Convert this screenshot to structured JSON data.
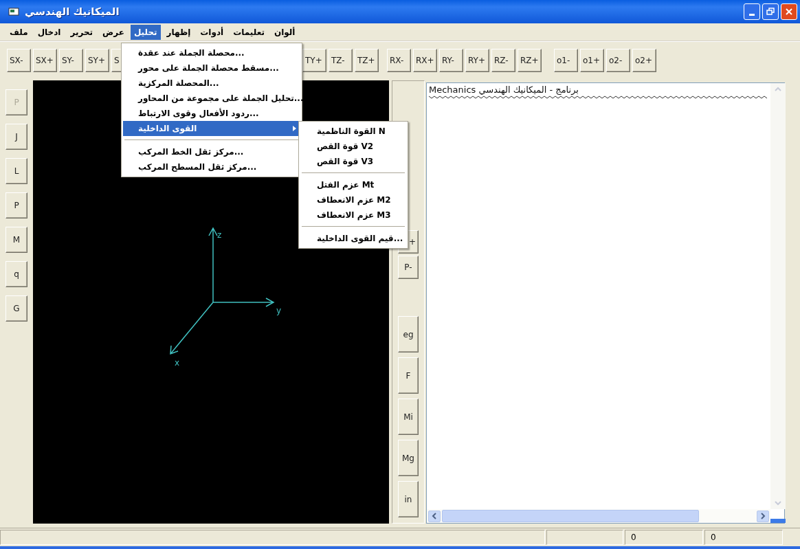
{
  "window": {
    "title": "الميكانيك الهندسي"
  },
  "menu_bar": [
    {
      "label": "ألوان",
      "selected": false
    },
    {
      "label": "تعليمات",
      "selected": false
    },
    {
      "label": "أدوات",
      "selected": false
    },
    {
      "label": "إظهار",
      "selected": false
    },
    {
      "label": "تحليل",
      "selected": true
    },
    {
      "label": "عرض",
      "selected": false
    },
    {
      "label": "تحرير",
      "selected": false
    },
    {
      "label": "ادخال",
      "selected": false
    },
    {
      "label": "ملف",
      "selected": false
    }
  ],
  "toolbar_groups": [
    [
      "o2+",
      "o2-",
      "o1+",
      "o1-"
    ],
    [
      "RZ+",
      "RZ-",
      "RY+",
      "RY-",
      "RX+",
      "RX-"
    ],
    [
      "TZ+",
      "TZ-",
      "TY+"
    ],
    [
      "S",
      "SY+",
      "SY-",
      "SX+",
      "SX-"
    ]
  ],
  "left_buttons": [
    {
      "label": "P",
      "disabled": true
    },
    {
      "label": "J",
      "disabled": false
    },
    {
      "label": "L",
      "disabled": false
    },
    {
      "label": "P",
      "disabled": false
    },
    {
      "label": "M",
      "disabled": false
    },
    {
      "label": "q",
      "disabled": false
    },
    {
      "label": "G",
      "disabled": false
    }
  ],
  "canvas": {
    "axis_labels": [
      "z",
      "y",
      "x"
    ]
  },
  "right_button_groups": [
    [
      "+",
      "P-"
    ],
    [
      "eg",
      "F",
      "Mi",
      "Mg",
      "in"
    ]
  ],
  "output": {
    "header": "Mechanics برنامج - الميكانيك الهندسي"
  },
  "dropdown": [
    {
      "kind": "item",
      "label": "محصلة الجملة عند عقدة...",
      "selected": false
    },
    {
      "kind": "item",
      "label": "مسقط محصلة الجملة على محور...",
      "selected": false
    },
    {
      "kind": "item",
      "label": "المحصلة المركزية...",
      "selected": false
    },
    {
      "kind": "item",
      "label": "تحليل الجملة على مجموعة من المحاور...",
      "selected": false
    },
    {
      "kind": "item",
      "label": "ردود الأفعال وقوى الارتباط...",
      "selected": false
    },
    {
      "kind": "submenu",
      "label": "القوى الداخلية",
      "selected": true
    },
    {
      "kind": "separator"
    },
    {
      "kind": "item",
      "label": "مركز ثقل الخط المركب...",
      "selected": false
    },
    {
      "kind": "item",
      "label": "مركز ثقل المسطح المركب...",
      "selected": false
    }
  ],
  "submenu": [
    {
      "kind": "item",
      "label": "القوة الناظمية  N",
      "selected": false
    },
    {
      "kind": "item",
      "label": "قوة القص  V2",
      "selected": false
    },
    {
      "kind": "item",
      "label": "قوة القص  V3",
      "selected": false
    },
    {
      "kind": "separator"
    },
    {
      "kind": "item",
      "label": "عزم الفتل  Mt",
      "selected": false
    },
    {
      "kind": "item",
      "label": "عزم الانعطاف  M2",
      "selected": false
    },
    {
      "kind": "item",
      "label": "عزم الانعطاف  M3",
      "selected": false
    },
    {
      "kind": "separator"
    },
    {
      "kind": "item",
      "label": "قيم القوى الداخلية...",
      "selected": false
    }
  ],
  "status_bar": {
    "panels": [
      "0",
      "0"
    ]
  }
}
